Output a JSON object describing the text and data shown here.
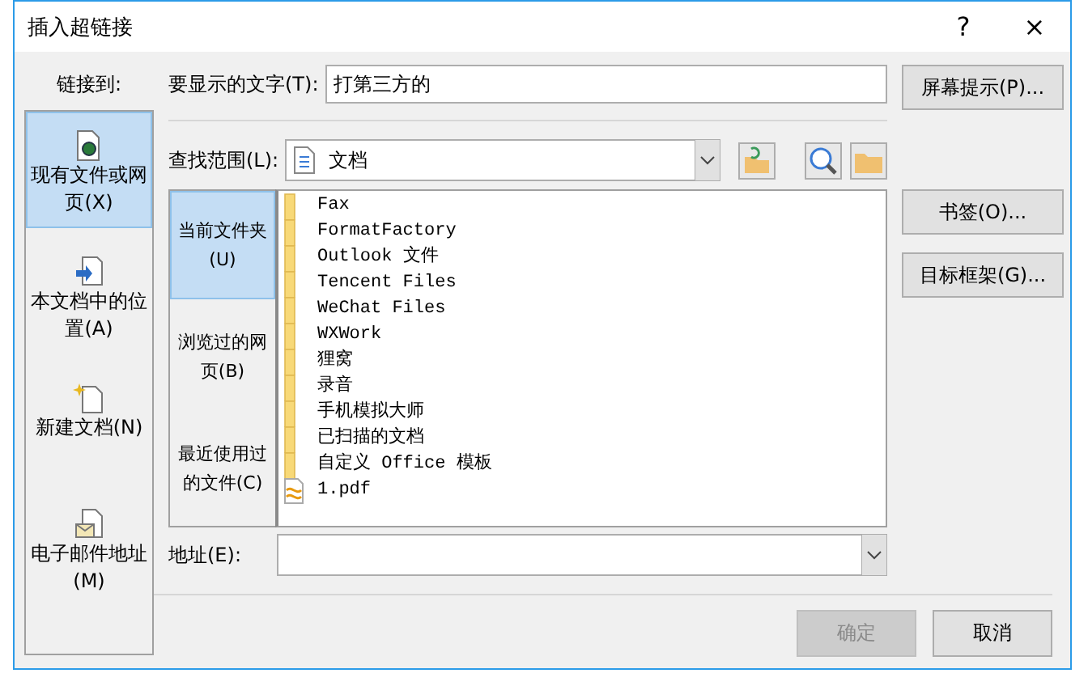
{
  "window": {
    "title": "插入超链接",
    "buttons": [
      "?",
      "×"
    ]
  },
  "link_to": {
    "label": "链接到:",
    "items": [
      {
        "label": "现有文件或网页(X)",
        "kind": "file",
        "selected": true
      },
      {
        "label": "本文档中的位置(A)",
        "kind": "place",
        "selected": false
      },
      {
        "label": "新建文档(N)",
        "kind": "new",
        "selected": false
      },
      {
        "label": "电子邮件地址(M)",
        "kind": "mail",
        "selected": false
      }
    ]
  },
  "display_text": {
    "label": "要显示的文字(T):",
    "value": "打第三方的"
  },
  "screen_tip_button": "屏幕提示(P)...",
  "look_in": {
    "label": "查找范围(L):",
    "value": "文档"
  },
  "sources": [
    {
      "label": "当前文件夹(U)",
      "selected": true
    },
    {
      "label": "浏览过的网页(B)",
      "selected": false
    },
    {
      "label": "最近使用过的文件(C)",
      "selected": false
    }
  ],
  "files": [
    {
      "name": "Fax",
      "kind": "folder"
    },
    {
      "name": "FormatFactory",
      "kind": "folder"
    },
    {
      "name": "Outlook 文件",
      "kind": "folder"
    },
    {
      "name": "Tencent Files",
      "kind": "folder"
    },
    {
      "name": "WeChat Files",
      "kind": "folder"
    },
    {
      "name": "WXWork",
      "kind": "folder"
    },
    {
      "name": "狸窝",
      "kind": "folder"
    },
    {
      "name": "录音",
      "kind": "folder"
    },
    {
      "name": "手机模拟大师",
      "kind": "folder"
    },
    {
      "name": "已扫描的文档",
      "kind": "folder"
    },
    {
      "name": "自定义 Office 模板",
      "kind": "folder"
    },
    {
      "name": "1.pdf",
      "kind": "pdf"
    }
  ],
  "side_buttons": [
    "书签(O)...",
    "目标框架(G)..."
  ],
  "address": {
    "label": "地址(E):"
  },
  "buttons": [
    {
      "label": "确定",
      "disabled": true
    },
    {
      "label": "取消",
      "disabled": false
    }
  ]
}
